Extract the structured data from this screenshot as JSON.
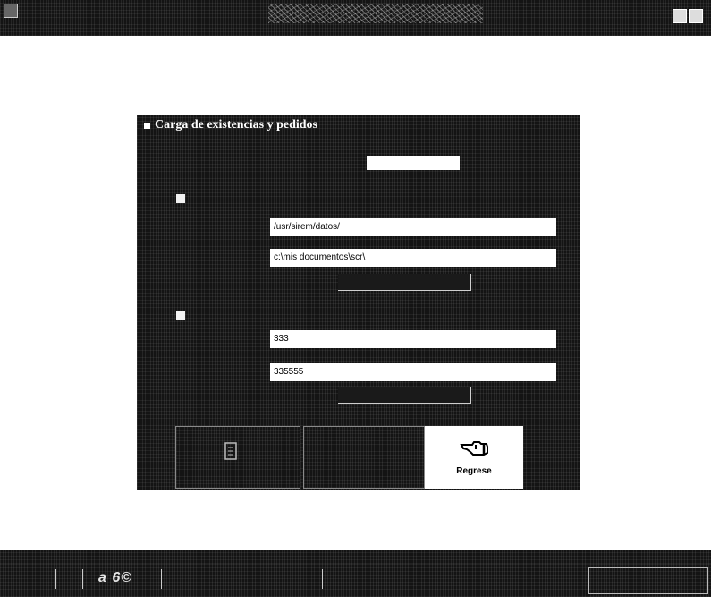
{
  "dialog": {
    "title": "Carga de existencias y pedidos",
    "fields": {
      "remote_path": "/usr/sirem/datos/",
      "local_path": "c:\\mis documentos\\scr\\",
      "value_1": "333",
      "value_2": "335555"
    },
    "buttons": {
      "back_label": "Regrese"
    }
  },
  "taskbar": {
    "quick_text": "a 6©"
  },
  "colors": {
    "background": "#ffffff",
    "dark_panel": "#141414",
    "field": "#ffffff"
  },
  "icons": {
    "back_button_icon": "pointing-hand-icon",
    "dialog_icon": "window-icon"
  }
}
